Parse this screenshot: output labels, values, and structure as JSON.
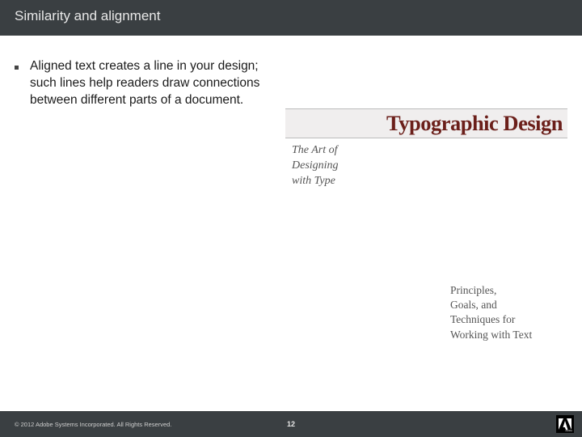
{
  "header": {
    "title": "Similarity and alignment"
  },
  "bullets": [
    {
      "text": "Aligned text creates a line in your design; such lines help readers draw connections between different parts of a document."
    }
  ],
  "example": {
    "heading": "Typographic Design",
    "subtitle_l1": "The Art of",
    "subtitle_l2": "Designing",
    "subtitle_l3": "with Type",
    "principles_l1": "Principles,",
    "principles_l2": "Goals, and",
    "principles_l3": "Techniques for",
    "principles_l4": "Working with Text"
  },
  "footer": {
    "copyright": "© 2012 Adobe Systems Incorporated. All Rights Reserved.",
    "page_number": "12",
    "brand": "Adobe"
  }
}
